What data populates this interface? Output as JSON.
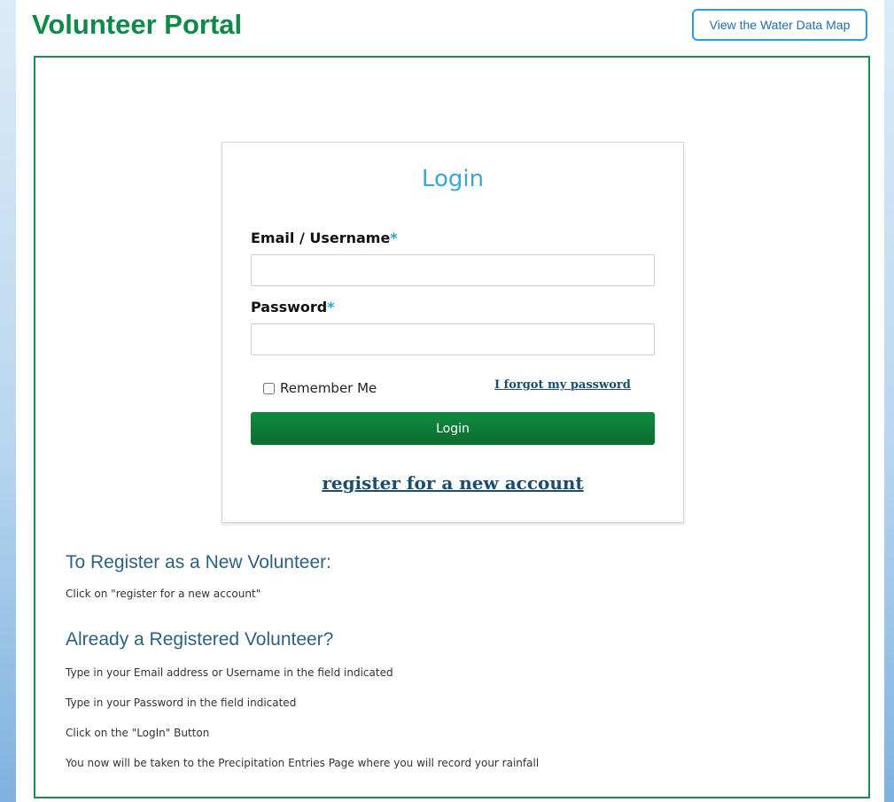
{
  "header": {
    "title": "Volunteer Portal",
    "map_button_label": "View the Water Data Map"
  },
  "login": {
    "heading": "Login",
    "email_label": "Email / Username",
    "password_label": "Password",
    "required_marker": "*",
    "email_value": "",
    "password_value": "",
    "remember_me_label": "Remember Me",
    "remember_me_checked": false,
    "forgot_password_label": "I forgot my password",
    "submit_label": "Login",
    "register_label": "register for a new account"
  },
  "help": {
    "new_volunteer_heading": "To Register as a New Volunteer:",
    "new_volunteer_text": "Click on \"register for a new account\"",
    "registered_heading": "Already a Registered Volunteer?",
    "steps": [
      "Type in your Email address or Username in the field indicated",
      "Type in your Password in the field indicated",
      "Click on the \"LogIn\" Button",
      "You now will be taken to the Precipitation Entries Page where you will record your rainfall"
    ]
  },
  "colors": {
    "brand_green": "#0d8a45",
    "panel_border": "#1e8a4b",
    "accent_blue": "#2a9fd6",
    "link_navy": "#1a4e6b"
  }
}
